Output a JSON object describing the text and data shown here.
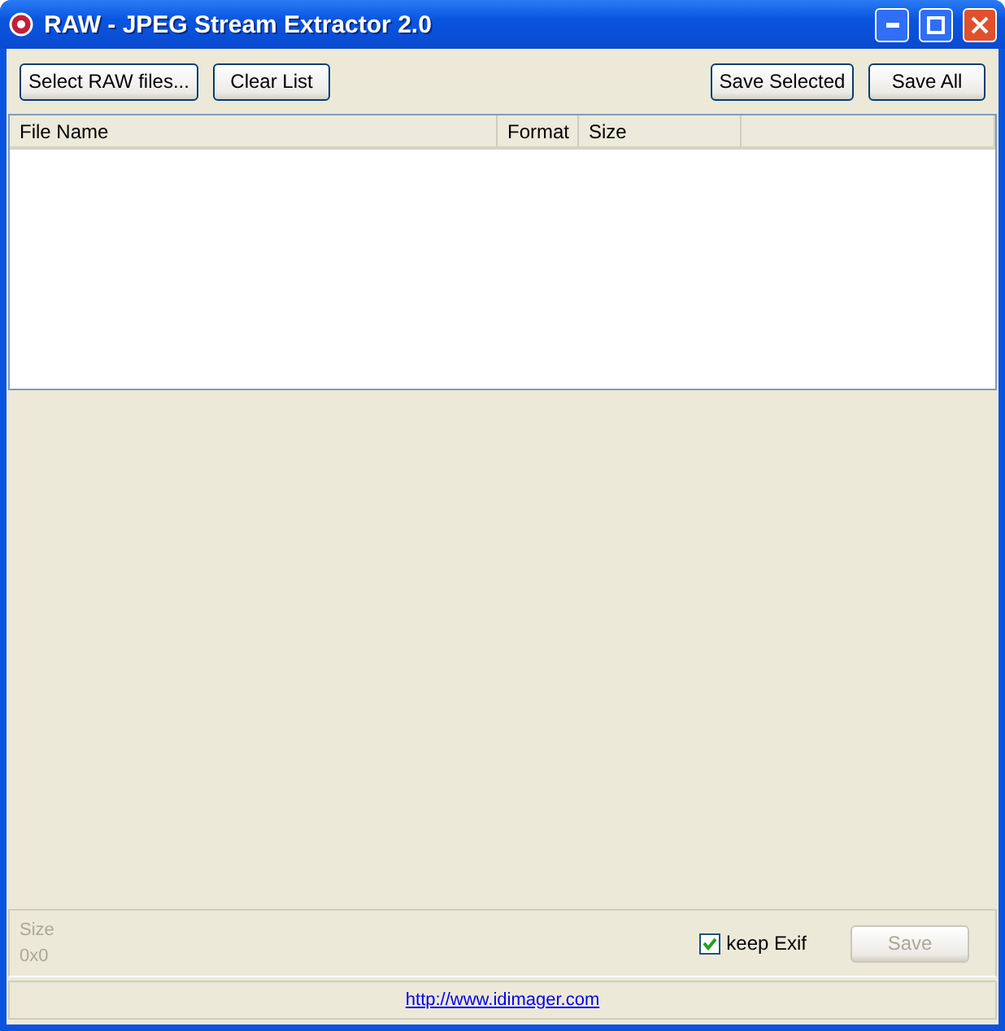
{
  "window": {
    "title": "RAW - JPEG Stream Extractor 2.0"
  },
  "toolbar": {
    "left_buttons": [
      "Select RAW files...",
      "Clear List"
    ],
    "right_buttons": [
      "Save Selected",
      "Save All"
    ]
  },
  "table": {
    "columns": [
      "File Name",
      "Format",
      "Size"
    ]
  },
  "preview": {
    "size_label": "Size",
    "size_value": "0x0",
    "disabled": true
  },
  "keep_exif": {
    "label": "keep Exif",
    "checked": true
  },
  "save_button": {
    "label": "Save",
    "disabled": true
  },
  "footer": {
    "link": "http://www.idimager.com"
  }
}
